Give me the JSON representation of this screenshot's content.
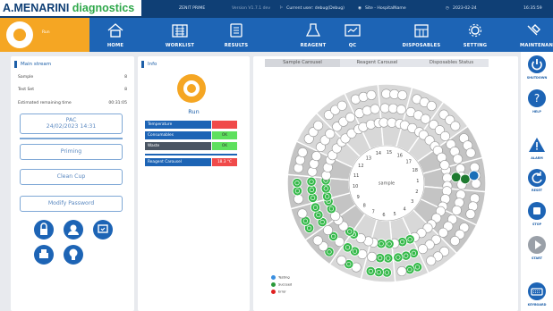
{
  "topbar": {
    "logo_a": "A.MENARINI",
    "logo_b": " diagnostics",
    "instrument": "ZENIT PRIME",
    "version": "Version V1.7.1 dev",
    "current_user": "Current user:  debug(Debug)",
    "site": "Site -  HospitalName",
    "date": "2023-02-24",
    "time": "16:35:59"
  },
  "navbar": {
    "status_label": "Run",
    "items": [
      {
        "label": "HOME",
        "icon": "home-icon"
      },
      {
        "label": "WORKLIST",
        "icon": "worklist-icon"
      },
      {
        "label": "RESULTS",
        "icon": "results-icon"
      },
      {
        "label": "REAGENT",
        "icon": "reagent-icon"
      },
      {
        "label": "QC",
        "icon": "qc-icon"
      },
      {
        "label": "DISPOSABLES",
        "icon": "disposables-icon"
      },
      {
        "label": "SETTING",
        "icon": "setting-icon"
      },
      {
        "label": "MAINTENANCE",
        "icon": "maintenance-icon"
      }
    ]
  },
  "main_stream": {
    "title": "Main stream",
    "rows": [
      {
        "label": "Sample",
        "value": "8"
      },
      {
        "label": "Test Set",
        "value": "8"
      },
      {
        "label": "Estimated remaining time",
        "value": "00:31:05"
      }
    ],
    "pac_line1": "PAC",
    "pac_line2": "24/02/2023 14:31",
    "priming": "Priming",
    "clean_cup": "Clean Cup",
    "modify_password": "Modify Password"
  },
  "info": {
    "title": "Info",
    "status": "Run",
    "bars": [
      {
        "name": "Temperature",
        "value": "",
        "name_color": "#1d64b5",
        "value_color": "#f04a4a"
      },
      {
        "name": "Consumables",
        "value": "OK",
        "name_color": "#1d64b5",
        "value_color": "#5ee05e"
      },
      {
        "name": "Waste",
        "value": "OK",
        "name_color": "#4a5563",
        "value_color": "#5ee05e"
      },
      {
        "name": "Reagent Carousel",
        "value": "18.3 °C",
        "name_color": "#1d64b5",
        "value_color": "#f04a4a"
      }
    ]
  },
  "carousel_tabs": {
    "tabs": [
      "Sample Carousel",
      "Reagent Carousel",
      "Disposables Status"
    ],
    "selected": 0
  },
  "carousel": {
    "center_label": "sample",
    "sector_numbers": [
      "1",
      "2",
      "3",
      "4",
      "5",
      "6",
      "7",
      "8",
      "9",
      "10",
      "11",
      "12",
      "13",
      "14",
      "15",
      "16",
      "17",
      "18"
    ]
  },
  "legend": [
    {
      "label": "Testing",
      "color": "#3a8fe0"
    },
    {
      "label": "Succeed",
      "color": "#2a9a3a"
    },
    {
      "label": "Error",
      "color": "#e02020"
    }
  ],
  "sidebar": [
    {
      "label": "SHUTDOWN",
      "icon": "power-icon"
    },
    {
      "label": "HELP",
      "icon": "help-icon"
    },
    {
      "label": "ALARM",
      "icon": "alarm-icon"
    },
    {
      "label": "RESET",
      "icon": "reset-icon"
    },
    {
      "label": "STOP",
      "icon": "stop-icon"
    },
    {
      "label": "START",
      "icon": "start-icon"
    },
    {
      "label": "KEYBOARD",
      "icon": "keyboard-icon"
    }
  ]
}
